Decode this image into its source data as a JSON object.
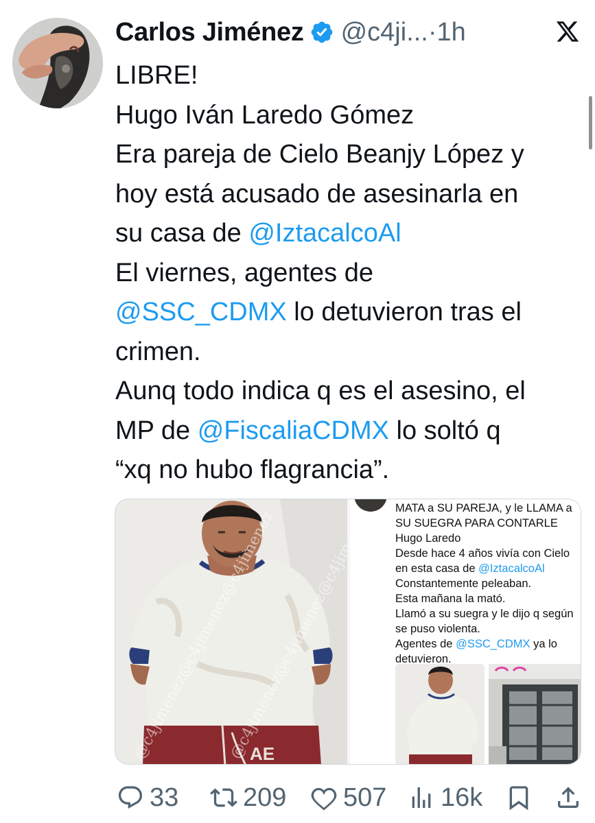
{
  "author": {
    "name": "Carlos Jiménez",
    "handle": "@c4ji...",
    "separator": "·",
    "time": "1h"
  },
  "tweet_lines": [
    [
      {
        "t": "LIBRE!"
      }
    ],
    [
      {
        "t": "Hugo Iván Laredo Gómez"
      }
    ],
    [
      {
        "t": "Era pareja de Cielo Beanjy López y"
      }
    ],
    [
      {
        "t": "hoy está acusado de asesinarla en"
      }
    ],
    [
      {
        "t": "su casa de "
      },
      {
        "t": "@IztacalcoAl",
        "m": true
      }
    ],
    [
      {
        "t": "El viernes, agentes de"
      }
    ],
    [
      {
        "t": "@SSC_CDMX",
        "m": true
      },
      {
        "t": " lo detuvieron tras el"
      }
    ],
    [
      {
        "t": "crimen."
      }
    ],
    [
      {
        "t": "Aunq todo indica q es el asesino, el"
      }
    ],
    [
      {
        "t": "MP de "
      },
      {
        "t": "@FiscaliaCDMX",
        "m": true
      },
      {
        "t": " lo soltó q"
      }
    ],
    [
      {
        "t": "“xq no hubo flagrancia”."
      }
    ]
  ],
  "media": {
    "watermark": "@c4jimenez@c4jimenez@c4jimenez",
    "shorts_text": "AE",
    "inner_tweet_lines": [
      [
        {
          "t": "MATA a SU PAREJA, y le LLAMA a"
        }
      ],
      [
        {
          "t": "SU SUEGRA PARA CONTARLE"
        }
      ],
      [
        {
          "t": "Hugo Laredo"
        }
      ],
      [
        {
          "t": "Desde hace 4 años vivía con Cielo"
        }
      ],
      [
        {
          "t": "en esta casa de "
        },
        {
          "t": "@IztacalcoAl",
          "m": true
        }
      ],
      [
        {
          "t": "Constantemente peleaban."
        }
      ],
      [
        {
          "t": "Esta mañana la mató."
        }
      ],
      [
        {
          "t": "Llamó a su suegra y le dijo q según"
        }
      ],
      [
        {
          "t": "se puso violenta."
        }
      ],
      [
        {
          "t": "Agentes de "
        },
        {
          "t": "@SSC_CDMX",
          "m": true
        },
        {
          "t": " ya lo"
        }
      ],
      [
        {
          "t": "detuvieron."
        }
      ]
    ]
  },
  "actions": {
    "replies": "33",
    "reposts": "209",
    "likes": "507",
    "views": "16k"
  },
  "colors": {
    "link": "#1d9bf0",
    "muted": "#536471",
    "text": "#0f1419",
    "verified": "#1d9bf0"
  },
  "icons": [
    "x-logo-icon",
    "verified-badge-icon",
    "reply-icon",
    "repost-icon",
    "like-icon",
    "views-icon",
    "bookmark-icon",
    "share-icon"
  ]
}
